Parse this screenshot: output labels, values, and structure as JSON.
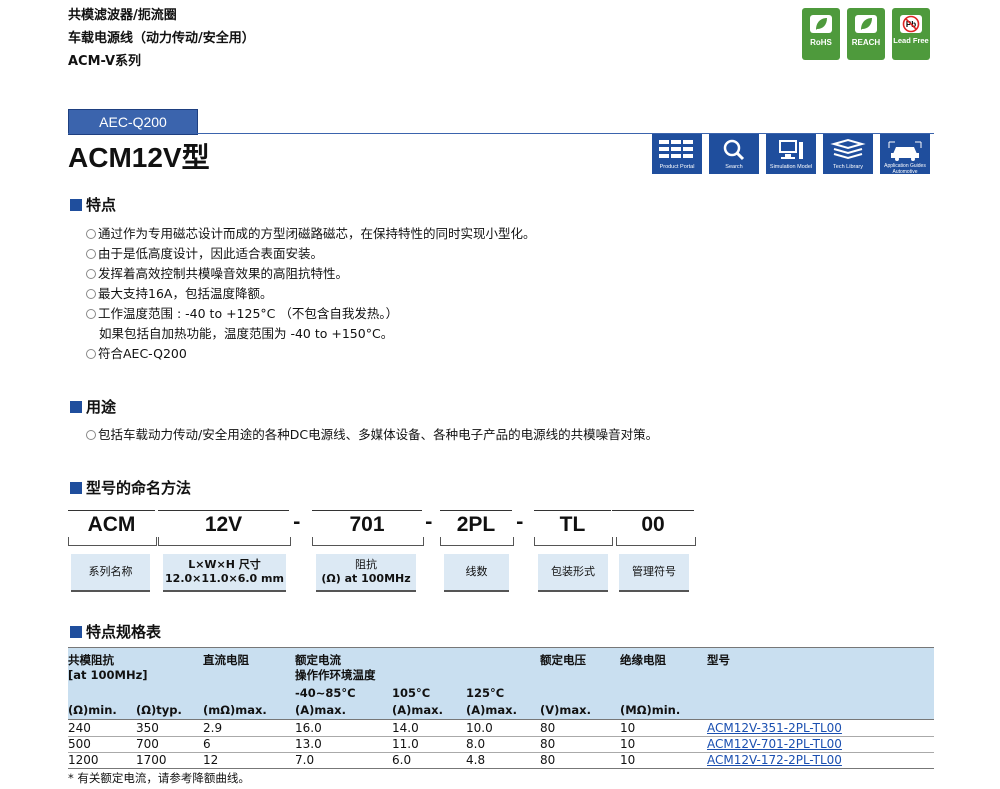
{
  "header": {
    "line1": "共模滤波器/扼流圈",
    "line2": "车载电源线（动力传动/安全用）",
    "line3": "ACM-V系列"
  },
  "certs": [
    {
      "label": "RoHS",
      "icon": "leaf-icon"
    },
    {
      "label": "REACH",
      "icon": "leaf-icon"
    },
    {
      "label": "Lead Free",
      "icon": "no-pb-icon",
      "badge": "Pb"
    }
  ],
  "badge": "AEC-Q200",
  "title": "ACM12V型",
  "nav": [
    {
      "label": "Product Portal",
      "icon": "product-portal-icon"
    },
    {
      "label": "Search",
      "icon": "search-icon"
    },
    {
      "label": "Simulation Model",
      "icon": "simulation-model-icon"
    },
    {
      "label": "Tech Library",
      "icon": "tech-library-icon"
    },
    {
      "label": "Application Guides Automotive",
      "icon": "automotive-guide-icon"
    }
  ],
  "features": {
    "heading": "特点",
    "items": [
      "通过作为专用磁芯设计而成的方型闭磁路磁芯，在保持特性的同时实现小型化。",
      "由于是低高度设计，因此适合表面安装。",
      "发挥着高效控制共模噪音效果的高阻抗特性。",
      "最大支持16A，包括温度降额。",
      "工作温度范围 : -40 to +125°C （不包含自我发热。）",
      "符合AEC-Q200"
    ],
    "continuation": "如果包括自加热功能，温度范围为 -40 to +150°C。"
  },
  "uses": {
    "heading": "用途",
    "items": [
      "包括车载动力传动/安全用途的各种DC电源线、多媒体设备、各种电子产品的电源线的共模噪音对策。"
    ]
  },
  "naming": {
    "heading": "型号的命名方法",
    "parts": [
      "ACM",
      "12V",
      "701",
      "2PL",
      "TL",
      "00"
    ],
    "dash": "-",
    "labels": [
      "系列名称",
      "L×W×H 尺寸",
      "阻抗",
      "线数",
      "包装形式",
      "管理符号"
    ],
    "sublabels": [
      "",
      "12.0×11.0×6.0 mm",
      "(Ω) at 100MHz",
      "",
      "",
      ""
    ]
  },
  "specs": {
    "heading": "特点规格表",
    "head": {
      "impedance": "共模阻抗",
      "impedance_sub": "[at 100MHz]",
      "dcr": "直流电阻",
      "rated_current": "额定电流",
      "env_temp": "操作作环境温度",
      "range1": "-40~85°C",
      "range2": "105°C",
      "range3": "125°C",
      "rated_voltage": "额定电压",
      "insulation": "绝缘电阻",
      "part": "型号"
    },
    "units": [
      "(Ω)min.",
      "(Ω)typ.",
      "(mΩ)max.",
      "(A)max.",
      "(A)max.",
      "(A)max.",
      "(V)max.",
      "(MΩ)min."
    ],
    "rows": [
      [
        "240",
        "350",
        "2.9",
        "16.0",
        "14.0",
        "10.0",
        "80",
        "10",
        "ACM12V-351-2PL-TL00"
      ],
      [
        "500",
        "700",
        "6",
        "13.0",
        "11.0",
        "8.0",
        "80",
        "10",
        "ACM12V-701-2PL-TL00"
      ],
      [
        "1200",
        "1700",
        "12",
        "7.0",
        "6.0",
        "4.8",
        "80",
        "10",
        "ACM12V-172-2PL-TL00"
      ]
    ],
    "note": "*  有关额定电流，请参考降额曲线。"
  }
}
